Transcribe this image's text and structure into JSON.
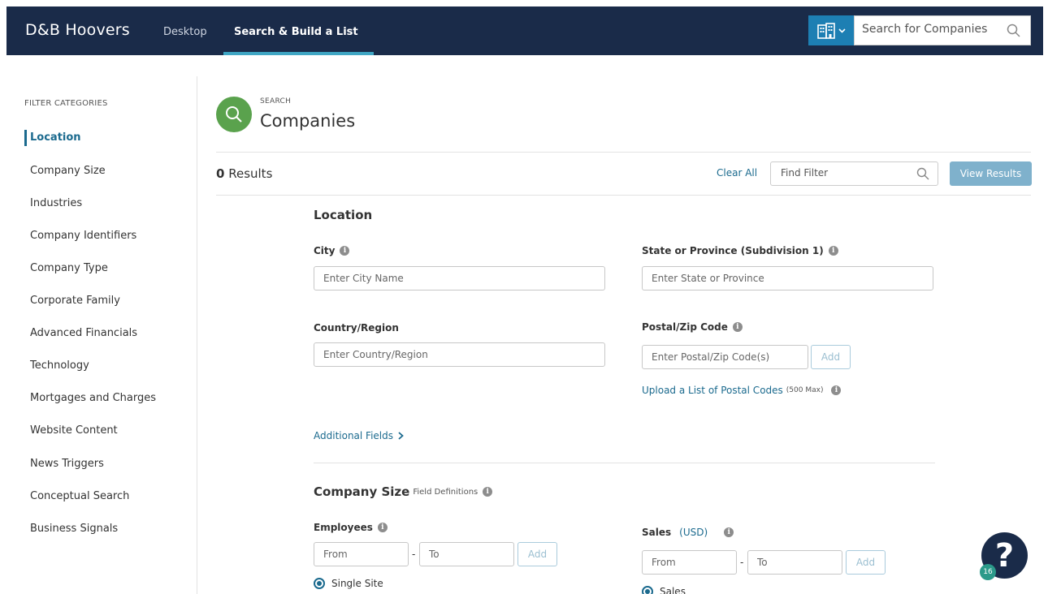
{
  "header": {
    "logo": "D&B Hoovers",
    "nav": [
      "Desktop",
      "Search & Build a List"
    ],
    "search_placeholder": "Search for Companies",
    "search_type_icon": "building-icon"
  },
  "sidebar": {
    "heading": "FILTER CATEGORIES",
    "items": [
      "Location",
      "Company Size",
      "Industries",
      "Company Identifiers",
      "Company Type",
      "Corporate Family",
      "Advanced Financials",
      "Technology",
      "Mortgages and Charges",
      "Website Content",
      "News Triggers",
      "Conceptual Search",
      "Business Signals"
    ],
    "active_item": "Location"
  },
  "main": {
    "kicker": "SEARCH",
    "title": "Companies",
    "results_count": "0",
    "results_label": "Results",
    "clear_all": "Clear All",
    "find_filter_placeholder": "Find Filter",
    "view_results": "View Results"
  },
  "location": {
    "title": "Location",
    "city_label": "City",
    "city_placeholder": "Enter City Name",
    "state_label": "State or Province (Subdivision 1)",
    "state_placeholder": "Enter State or Province",
    "country_label": "Country/Region",
    "country_placeholder": "Enter Country/Region",
    "postal_label": "Postal/Zip Code",
    "postal_placeholder": "Enter Postal/Zip Code(s)",
    "add": "Add",
    "upload_link": "Upload a List of Postal Codes",
    "upload_note": "(500 Max)",
    "additional_fields": "Additional Fields"
  },
  "company_size": {
    "title": "Company Size",
    "field_definitions": "Field Definitions",
    "employees_label": "Employees",
    "from_placeholder": "From",
    "to_placeholder": "To",
    "dash": "-",
    "add": "Add",
    "sales_label": "Sales",
    "sales_currency": "(USD)",
    "single_site": "Single Site",
    "sales_radio": "Sales"
  },
  "help": {
    "glyph": "?",
    "badge": "16"
  },
  "colors": {
    "nav_bg": "#1a2b49",
    "accent_link": "#1b6a8e",
    "search_green": "#5aa24d",
    "view_results_bg": "#7fb1cc"
  }
}
